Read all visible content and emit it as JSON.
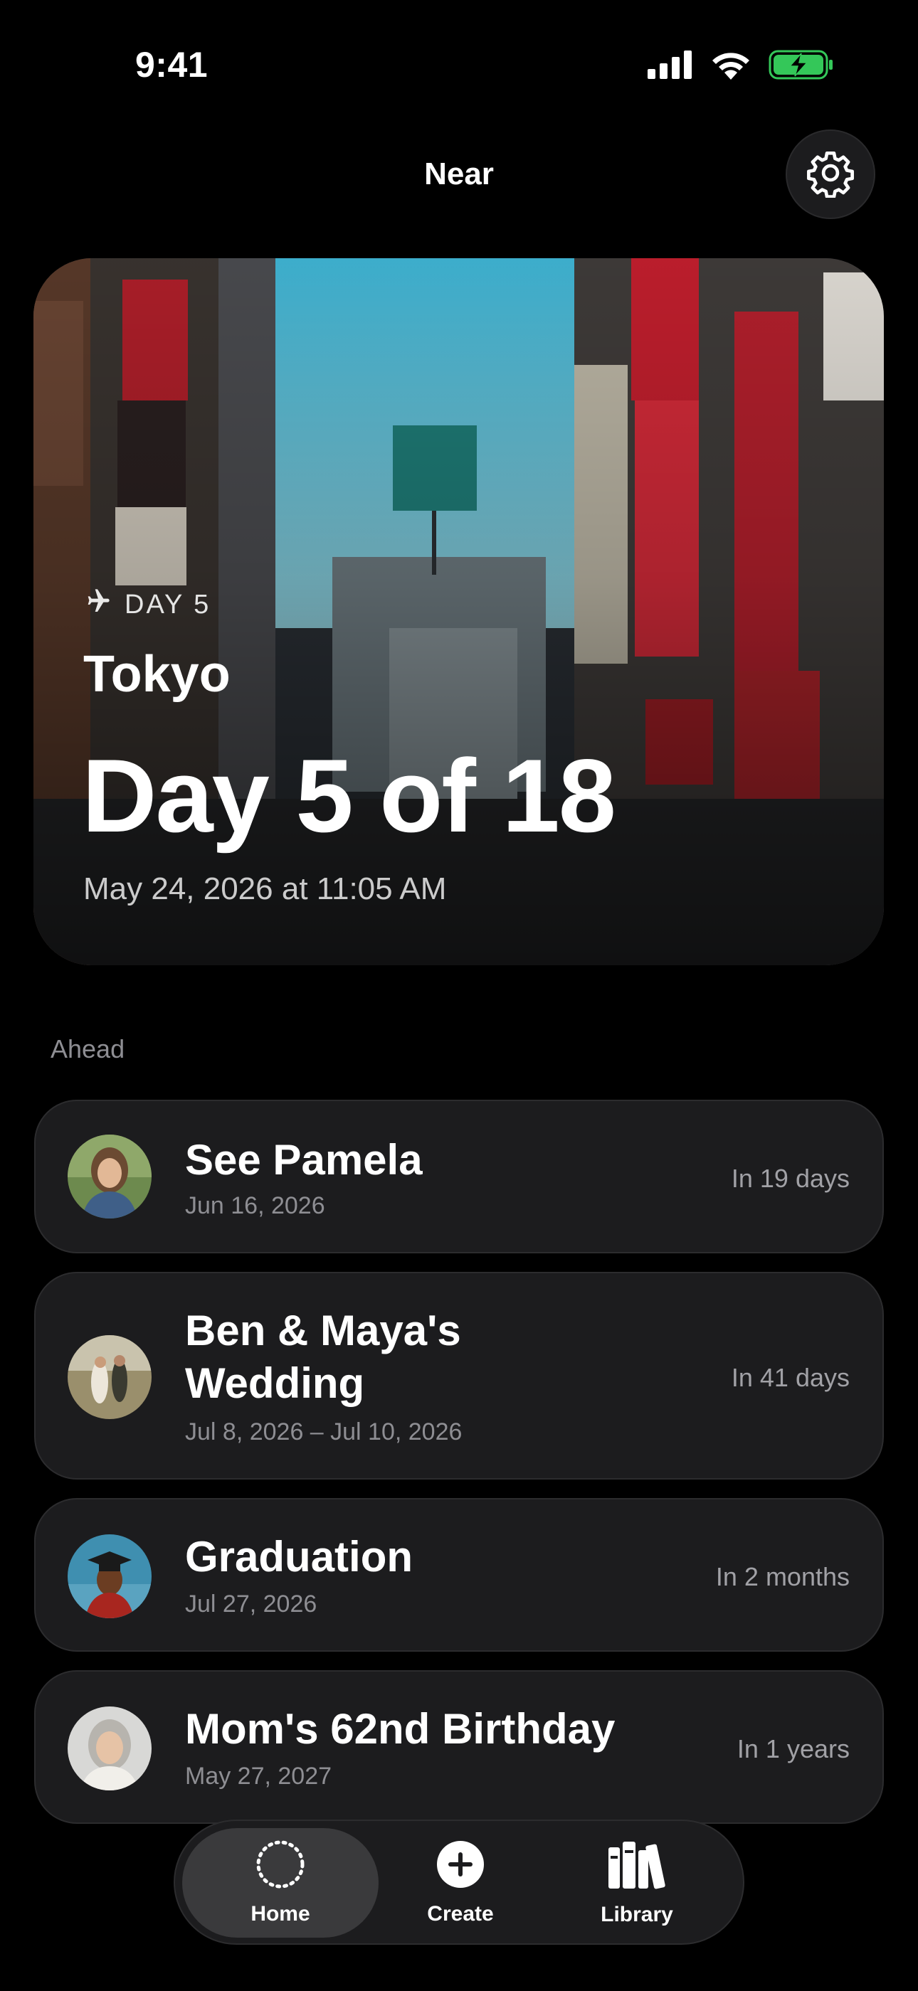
{
  "status_bar": {
    "time": "9:41"
  },
  "header": {
    "title": "Near",
    "settings_icon": "gear-icon"
  },
  "hero": {
    "eyebrow_icon": "airplane-icon",
    "eyebrow": "DAY 5",
    "city": "Tokyo",
    "day_progress": "Day 5 of 18",
    "datetime": "May 24, 2026 at 11:05 AM"
  },
  "ahead": {
    "label": "Ahead",
    "events": [
      {
        "title": "See Pamela",
        "date": "Jun 16, 2026",
        "relative": "In 19 days"
      },
      {
        "title": "Ben & Maya's Wedding",
        "date": "Jul 8, 2026 – Jul 10, 2026",
        "relative": "In 41 days"
      },
      {
        "title": "Graduation",
        "date": "Jul 27, 2026",
        "relative": "In 2 months"
      },
      {
        "title": "Mom's 62nd Birthday",
        "date": "May 27, 2027",
        "relative": "In 1 years"
      }
    ]
  },
  "tab_bar": {
    "tabs": [
      {
        "label": "Home",
        "icon": "dotted-circle-icon"
      },
      {
        "label": "Create",
        "icon": "plus-circle-icon"
      },
      {
        "label": "Library",
        "icon": "books-icon"
      }
    ]
  },
  "colors": {
    "background": "#000000",
    "card": "#1c1c1e",
    "secondary_text": "#8e8e93",
    "battery": "#34c759"
  }
}
